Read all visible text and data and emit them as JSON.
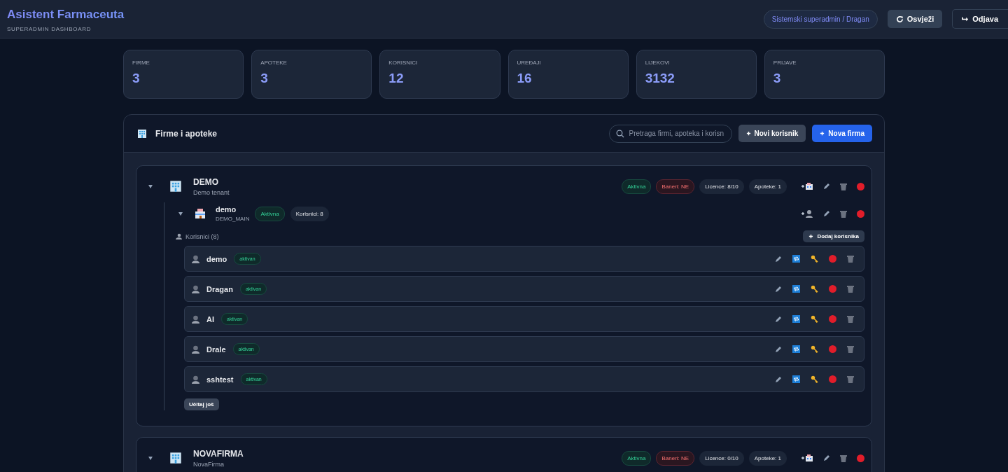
{
  "header": {
    "title": "Asistent Farmaceuta",
    "subtitle": "SUPERADMIN DASHBOARD",
    "user_badge": "Sistemski superadmin / Dragan",
    "refresh_button": "Osvježi",
    "logout_button": "Odjava"
  },
  "stats": [
    {
      "label": "FIRME",
      "value": "3"
    },
    {
      "label": "APOTEKE",
      "value": "3"
    },
    {
      "label": "KORISNICI",
      "value": "12"
    },
    {
      "label": "UREĐAJI",
      "value": "16"
    },
    {
      "label": "LIJEKOVI",
      "value": "3132"
    },
    {
      "label": "PRIJAVE",
      "value": "3"
    }
  ],
  "panel": {
    "title": "Firme i apoteke",
    "search": {
      "placeholder": "Pretraga firmi, apoteka i korisn"
    },
    "buttons": [
      {
        "label": "Novi korisnik",
        "kind": "secondary"
      },
      {
        "label": "Nova firma",
        "kind": "primary"
      }
    ]
  },
  "companies": [
    {
      "name": "DEMO",
      "subtitle": "Demo tenant",
      "expanded": true,
      "badges": [
        {
          "label": "Aktivna",
          "kind": "success"
        },
        {
          "label": "Baneri: NE",
          "kind": "danger"
        },
        {
          "label": "Licence: 8/10",
          "kind": "neutral"
        },
        {
          "label": "Apoteke: 1",
          "kind": "neutral"
        }
      ],
      "pharmacies": [
        {
          "name": "demo",
          "code": "DEMO_MAIN",
          "expanded": true,
          "badges": [
            {
              "label": "Aktivna",
              "kind": "success"
            },
            {
              "label": "Korisnici: 8",
              "kind": "neutral"
            }
          ],
          "users_label": "Korisnici (8)",
          "add_user_button": "Dodaj korisnika",
          "load_more": "Učitaj još",
          "users": [
            {
              "name": "demo",
              "status": "aktivan"
            },
            {
              "name": "Dragan",
              "status": "aktivan"
            },
            {
              "name": "AI",
              "status": "aktivan"
            },
            {
              "name": "Drale",
              "status": "aktivan"
            },
            {
              "name": "sshtest",
              "status": "aktivan"
            }
          ]
        }
      ]
    },
    {
      "name": "NOVAFIRMA",
      "subtitle": "NovaFirma",
      "expanded": true,
      "badges": [
        {
          "label": "Aktivna",
          "kind": "success"
        },
        {
          "label": "Baneri: NE",
          "kind": "danger"
        },
        {
          "label": "Licence: 0/10",
          "kind": "neutral"
        },
        {
          "label": "Apoteke: 1",
          "kind": "neutral"
        }
      ]
    }
  ]
}
